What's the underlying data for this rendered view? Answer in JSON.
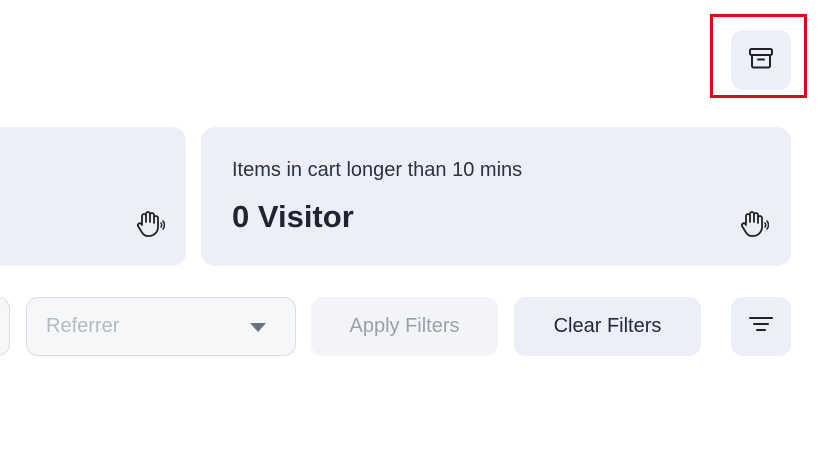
{
  "cards": [
    {
      "label": "",
      "value": ""
    },
    {
      "label": "Items in cart longer than 10 mins",
      "value": "0 Visitor"
    }
  ],
  "filters": {
    "referrer_placeholder": "Referrer",
    "apply_label": "Apply Filters",
    "clear_label": "Clear Filters"
  },
  "icons": {
    "archive": "archive-icon",
    "hand": "hand-wave-icon",
    "filter": "filter-lines-icon",
    "caret": "caret-down-icon"
  },
  "colors": {
    "card_bg": "#eceff7",
    "highlight": "#e3001b"
  }
}
